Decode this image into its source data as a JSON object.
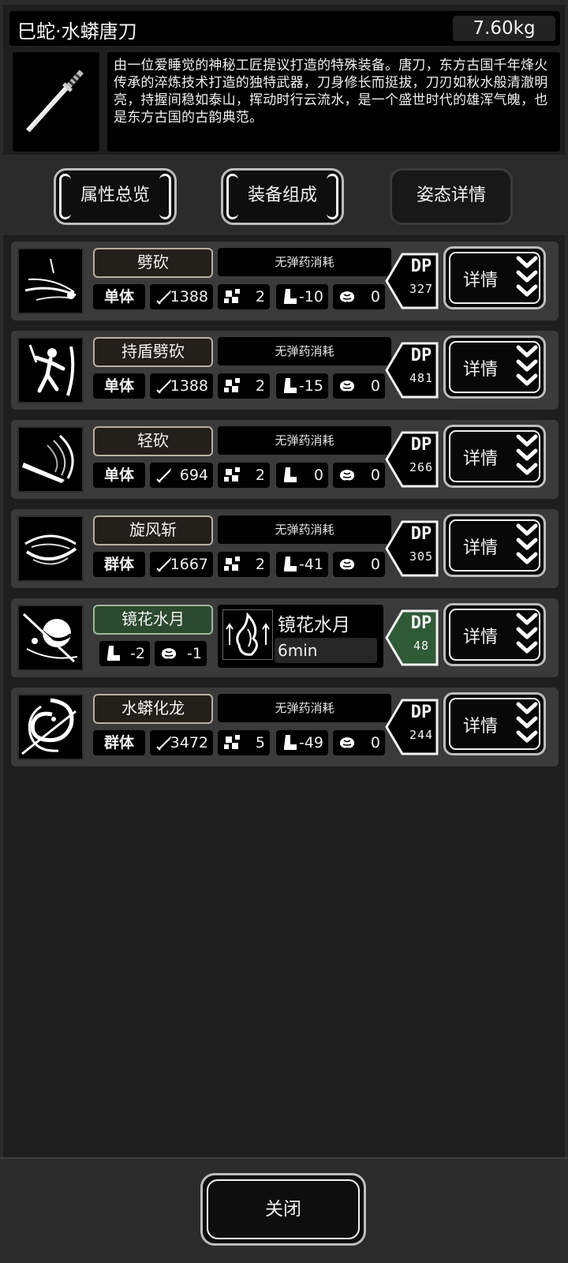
{
  "header": {
    "title": "巳蛇·水蟒唐刀",
    "weight": "7.60kg",
    "description": "由一位爱睡觉的神秘工匠提议打造的特殊装备。唐刀，东方古国千年烽火传承的淬炼技术打造的独特武器，刀身修长而挺拔，刀刃如秋水般清澈明亮，持握间稳如泰山，挥动时行云流水，是一个盛世时代的雄浑气魄，也是东方古国的古韵典范。",
    "weapon_icon": "katana-icon"
  },
  "tabs": [
    {
      "label": "属性总览"
    },
    {
      "label": "装备组成"
    },
    {
      "label": "姿态详情"
    }
  ],
  "skills": [
    {
      "name": "劈砍",
      "ammo": "无弹药消耗",
      "type": "单体",
      "attack": "1388",
      "hits": "2",
      "move": "-10",
      "brain": "0",
      "dp_label": "DP",
      "dp": "327",
      "detail": "详情",
      "icon": "slash-spark-icon"
    },
    {
      "name": "持盾劈砍",
      "ammo": "无弹药消耗",
      "type": "单体",
      "attack": "1388",
      "hits": "2",
      "move": "-15",
      "brain": "0",
      "dp_label": "DP",
      "dp": "481",
      "detail": "详情",
      "icon": "shield-warrior-icon"
    },
    {
      "name": "轻砍",
      "ammo": "无弹药消耗",
      "type": "单体",
      "attack": "694",
      "hits": "2",
      "move": "0",
      "brain": "0",
      "dp_label": "DP",
      "dp": "266",
      "detail": "详情",
      "icon": "light-slash-icon"
    },
    {
      "name": "旋风斩",
      "ammo": "无弹药消耗",
      "type": "群体",
      "attack": "1667",
      "hits": "2",
      "move": "-41",
      "brain": "0",
      "dp_label": "DP",
      "dp": "305",
      "detail": "详情",
      "icon": "whirlwind-icon"
    },
    {
      "name": "水蟒化龙",
      "ammo": "无弹药消耗",
      "type": "群体",
      "attack": "3472",
      "hits": "5",
      "move": "-49",
      "brain": "0",
      "dp_label": "DP",
      "dp": "244",
      "detail": "详情",
      "icon": "serpent-dragon-icon"
    }
  ],
  "special_skill": {
    "name": "镜花水月",
    "move": "-2",
    "brain": "-1",
    "buff_name": "镜花水月",
    "buff_duration": "6min",
    "dp_label": "DP",
    "dp": "48",
    "detail": "详情",
    "icon": "moon-slash-icon",
    "buff_icon": "flame-buff-icon"
  },
  "footer": {
    "close_label": "关闭"
  },
  "colors": {
    "special_green": "#2c4a2f",
    "badge_green": "#2f5a36"
  }
}
